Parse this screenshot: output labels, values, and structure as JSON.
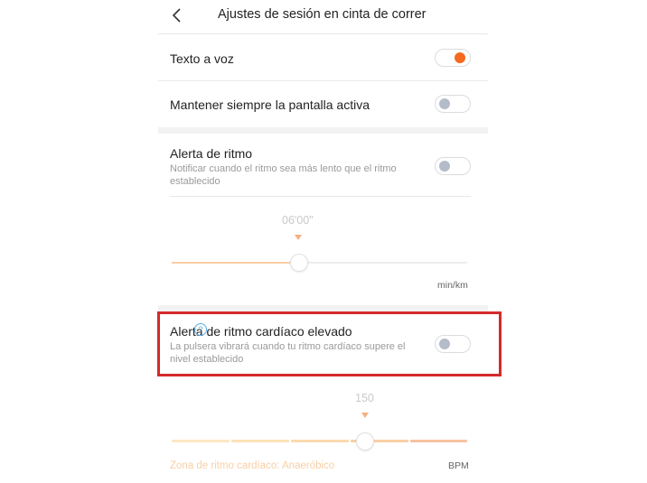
{
  "header": {
    "title": "Ajustes de sesión en cinta de correr",
    "back_icon": "chevron-left-icon"
  },
  "settings": {
    "tts": {
      "label": "Texto a voz",
      "enabled": true
    },
    "screen_on": {
      "label": "Mantener siempre la pantalla activa",
      "enabled": false
    },
    "pace_alert": {
      "label": "Alerta de ritmo",
      "description": "Notificar cuando el ritmo sea más lento que el ritmo establecido",
      "enabled": false,
      "value": "06'00\"",
      "unit": "min/km"
    },
    "hr_alert": {
      "label": "Alerta de ritmo cardíaco elevado",
      "help_icon": "question-mark-icon",
      "description": "La pulsera vibrará cuando tu ritmo cardíaco supere el nivel establecido",
      "enabled": false,
      "value": "150",
      "unit": "BPM",
      "zone": "Zona de ritmo cardíaco: Anaeróbico"
    }
  },
  "help_symbol": "?",
  "colors": {
    "accent": "#f56a1e",
    "highlight": "#d42a2a",
    "slider_fill": "#f9cfa6"
  }
}
